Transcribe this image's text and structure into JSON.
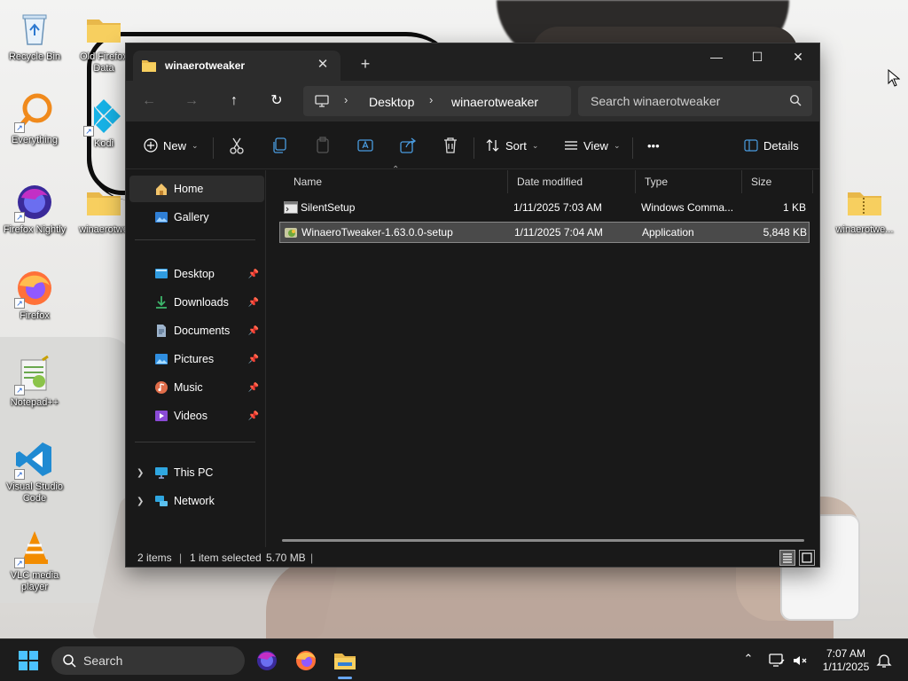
{
  "desktop": {
    "icons": [
      {
        "label": "Recycle Bin",
        "icon": "recycle-bin-icon"
      },
      {
        "label": "Old Firefox Data",
        "icon": "folder-icon"
      },
      {
        "label": "Everything",
        "icon": "everything-search-icon"
      },
      {
        "label": "Kodi",
        "icon": "kodi-icon"
      },
      {
        "label": "Firefox Nightly",
        "icon": "firefox-nightly-icon"
      },
      {
        "label": "winaerotwe",
        "icon": "folder-icon"
      },
      {
        "label": "Firefox",
        "icon": "firefox-icon"
      },
      {
        "label": "Notepad++",
        "icon": "notepadplusplus-icon"
      },
      {
        "label": "Visual Studio Code",
        "icon": "vscode-icon"
      },
      {
        "label": "VLC media player",
        "icon": "vlc-icon"
      },
      {
        "label": "winaerotwe...",
        "icon": "zip-folder-icon"
      }
    ]
  },
  "explorer": {
    "tab_title": "winaerotweaker",
    "tab_close": "✕",
    "new_tab": "+",
    "window_controls": {
      "minimize": "—",
      "maximize": "☐",
      "close": "✕"
    },
    "breadcrumb": [
      "Desktop",
      "winaerotweaker"
    ],
    "search_placeholder": "Search winaerotweaker",
    "commands": {
      "new": "New",
      "sort": "Sort",
      "view": "View",
      "more": "•••",
      "details": "Details"
    },
    "sidebar": {
      "top": [
        "Home",
        "Gallery"
      ],
      "pinned": [
        "Desktop",
        "Downloads",
        "Documents",
        "Pictures",
        "Music",
        "Videos"
      ],
      "bottom": [
        "This PC",
        "Network"
      ]
    },
    "columns": [
      "Name",
      "Date modified",
      "Type",
      "Size"
    ],
    "files": [
      {
        "name": "SilentSetup",
        "date": "1/11/2025 7:03 AM",
        "type": "Windows Comma...",
        "size": "1 KB",
        "selected": false
      },
      {
        "name": "WinaeroTweaker-1.63.0.0-setup",
        "date": "1/11/2025 7:04 AM",
        "type": "Application",
        "size": "5,848 KB",
        "selected": true
      }
    ],
    "status": {
      "items": "2 items",
      "selected": "1 item selected",
      "size": "5.70 MB"
    }
  },
  "taskbar": {
    "search_label": "Search",
    "time": "7:07 AM",
    "date": "1/11/2025",
    "accent": "#67a7f5"
  }
}
